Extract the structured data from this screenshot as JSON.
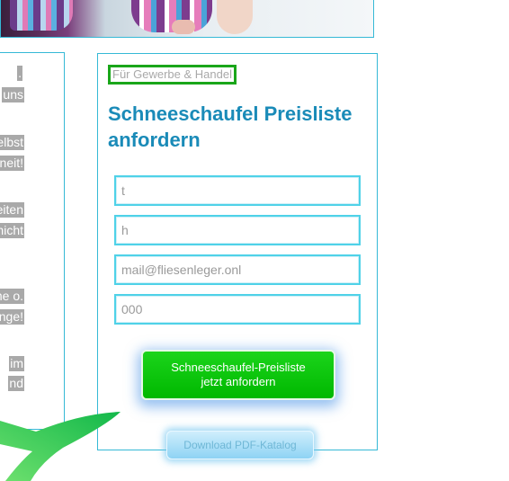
{
  "left_column": {
    "lines": [
      {
        "text": "."
      },
      {
        "text": "uns"
      },
      {
        "text": "Selbst"
      },
      {
        "text": "nneit!"
      },
      {
        "text": "eiten"
      },
      {
        "text": "e nicht"
      },
      {
        "text": "ahme o."
      },
      {
        "text": "nge!"
      },
      {
        "text": "im"
      },
      {
        "text": "nd"
      }
    ]
  },
  "form": {
    "badge": "Für Gewerbe & Handel",
    "title": "Schneeschaufel Preisliste anfordern",
    "fields": [
      {
        "value": "t",
        "placeholder": ""
      },
      {
        "value": "h",
        "placeholder": ""
      },
      {
        "value": "mail@fliesenleger.onl",
        "placeholder": ""
      },
      {
        "value": "000",
        "placeholder": ""
      }
    ],
    "submit_line1": "Schneeschaufel-Preisliste",
    "submit_line2": "jetzt anfordern",
    "download_label": "Download PDF-Katalog"
  },
  "colors": {
    "accent_blue": "#1a8bb8",
    "border_cyan": "#35b9d6",
    "submit_green": "#00b800",
    "badge_green": "#1aa61a"
  }
}
